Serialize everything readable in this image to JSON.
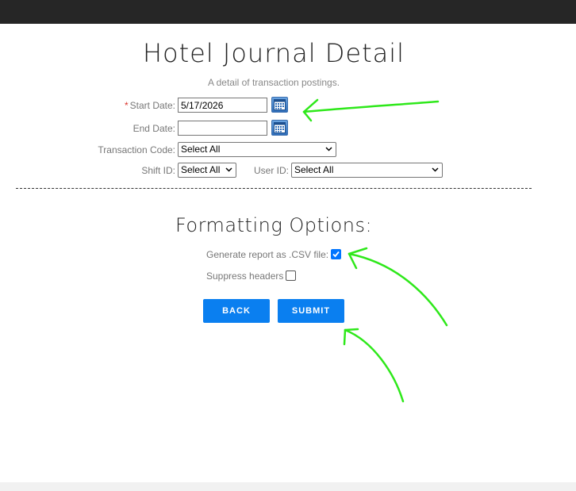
{
  "page": {
    "title": "Hotel Journal Detail",
    "subtitle": "A detail of transaction postings."
  },
  "form": {
    "start_date": {
      "required_mark": "*",
      "label": "Start Date:",
      "value": "5/17/2026"
    },
    "end_date": {
      "label": "End Date:",
      "value": ""
    },
    "transaction_code": {
      "label": "Transaction Code:",
      "selected": "Select All"
    },
    "shift_id": {
      "label": "Shift ID:",
      "selected": "Select All"
    },
    "user_id": {
      "label": "User ID:",
      "selected": "Select All"
    }
  },
  "formatting": {
    "title": "Formatting Options:",
    "csv": {
      "label": "Generate report as .CSV file:",
      "checked": true
    },
    "suppress_headers": {
      "label": "Suppress headers",
      "checked": false
    }
  },
  "buttons": {
    "back": "BACK",
    "submit": "SUBMIT"
  },
  "icons": {
    "calendar": "calendar-icon",
    "dropdown": "chevron-down-icon",
    "checkmark": "checkmark-icon"
  },
  "colors": {
    "topbar": "#262626",
    "accent": "#0a7ff0",
    "annotation": "#2ee81a",
    "required": "#d9322b"
  }
}
